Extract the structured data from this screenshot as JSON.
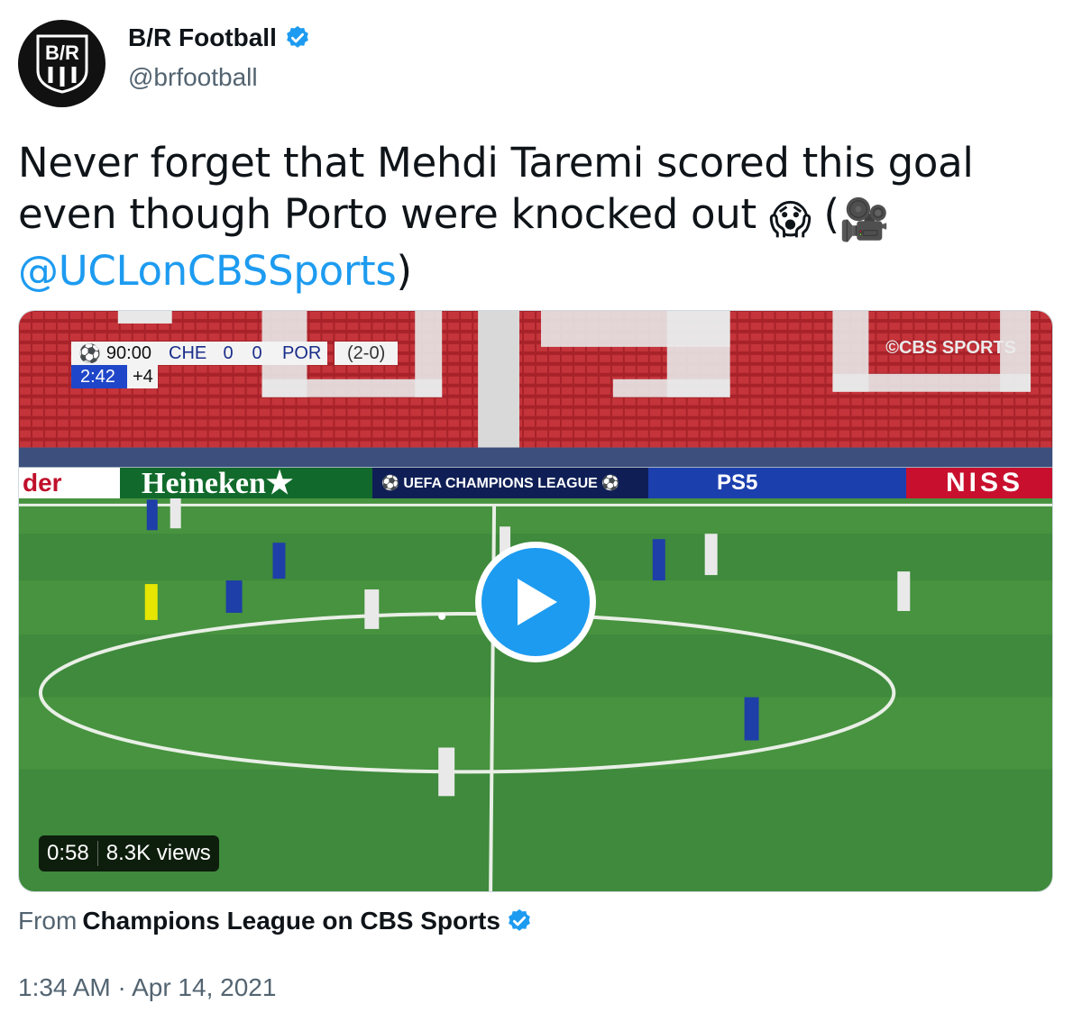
{
  "author": {
    "display_name": "B/R Football",
    "handle": "@brfootball",
    "avatar_text": "B/R",
    "verified": true
  },
  "tweet": {
    "text_line": "Never forget that Mehdi Taremi scored this goal even though Porto were knocked out",
    "emoji_scream": "😱",
    "paren_open": "(",
    "emoji_camera": "🎥",
    "mention": "@UCLonCBSSports",
    "paren_close": ")"
  },
  "video": {
    "scoreboard": {
      "clock": "90:00",
      "home": "CHE",
      "home_score": "0",
      "away_score": "0",
      "away": "POR",
      "aggregate": "(2-0)",
      "stoppage_elapsed": "2:42",
      "added_time": "+4"
    },
    "broadcaster_logo": "©CBS SPORTS",
    "boards": [
      "der",
      "Heineken★",
      "⚽ UEFA CHAMPIONS LEAGUE ⚽",
      "PS5",
      "NISS"
    ],
    "duration": "0:58",
    "views": "8.3K views",
    "play_icon": "play-icon"
  },
  "source": {
    "prefix": "From",
    "name": "Champions League on CBS Sports",
    "verified": true
  },
  "timestamp": "1:34 AM · Apr 14, 2021",
  "colors": {
    "link": "#1d9bf0",
    "secondary_text": "#536471",
    "pitch": "#3f8a3c",
    "stands": "#b3262c"
  }
}
